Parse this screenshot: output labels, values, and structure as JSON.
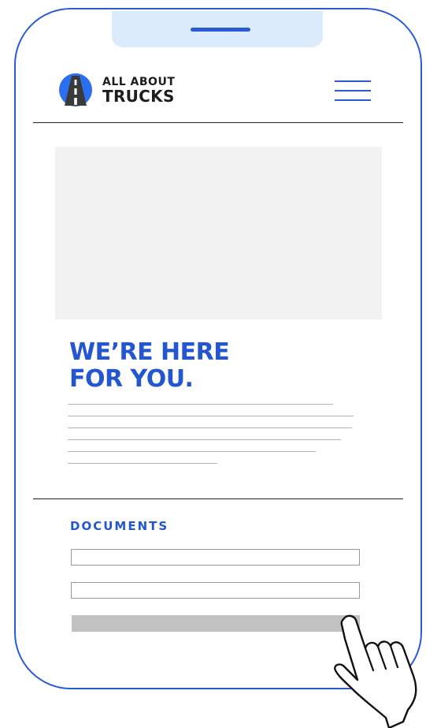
{
  "header": {
    "brand_line1": "ALL ABOUT",
    "brand_line2": "TRUCKS",
    "logo_icon": "road-icon",
    "menu_icon": "hamburger-menu-icon"
  },
  "hero": {
    "headline_line1": "WE’RE HERE",
    "headline_line2": "FOR YOU."
  },
  "documents": {
    "label": "DOCUMENTS",
    "field_count_visible": 2,
    "button_label": ""
  },
  "colors": {
    "accent": "#2356cf",
    "notch": "#dcebfb",
    "placeholder_image": "#f2f2f2",
    "button": "#c2c2c2"
  },
  "overlay": {
    "pointer_icon": "hand-pointer-icon"
  }
}
